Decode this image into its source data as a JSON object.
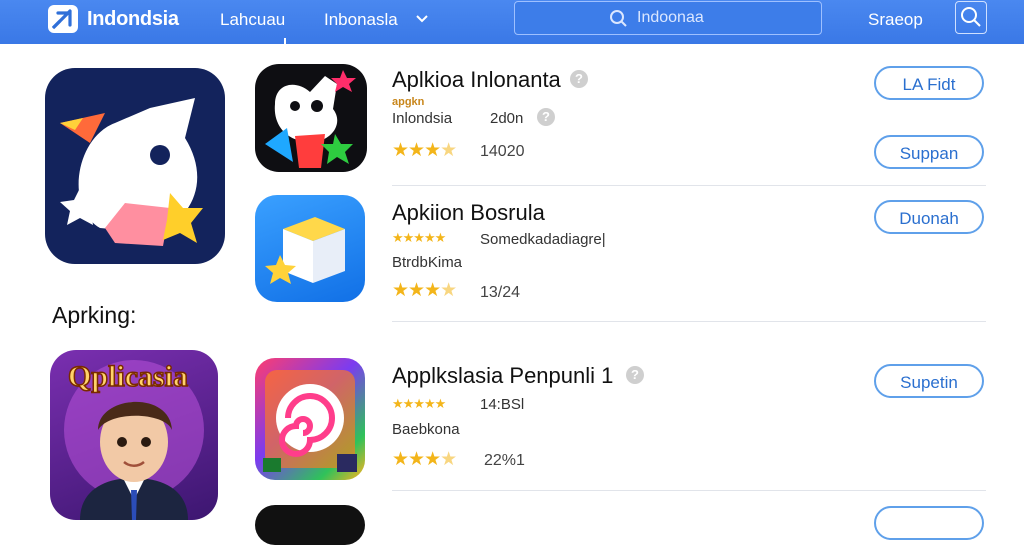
{
  "header": {
    "logo_text": "Indondsia",
    "nav_1": "Lahcuau",
    "nav_2": "Inbonasla",
    "search_placeholder": "Indoonaa",
    "sign_label": "Sraeop"
  },
  "section_label": "Aprking:",
  "apps": [
    {
      "title": "Aplkioa Inlonanta",
      "tag": "apgkn",
      "sub": "Inlondsia",
      "sub2": "2d0n",
      "rating_count": "14020",
      "button": "LA Fidt"
    },
    {
      "title": "",
      "button": "Suppan"
    },
    {
      "title": "Apkiion Bosrula",
      "sub": "Somedkadadiagre|",
      "sub2": "BtrdbKima",
      "rating_count": "13/24",
      "button": "Duonah"
    },
    {
      "title": "Applkslasia Penpunli 1",
      "sub": "14:BSl",
      "sub2": "Baebkona",
      "rating_count": "22%1",
      "button": "Supetin"
    }
  ],
  "big_icon_text": "Qplicasia",
  "colors": {
    "header": "#3a78e6",
    "accent": "#5fa0ea",
    "star": "#f3b51a"
  }
}
